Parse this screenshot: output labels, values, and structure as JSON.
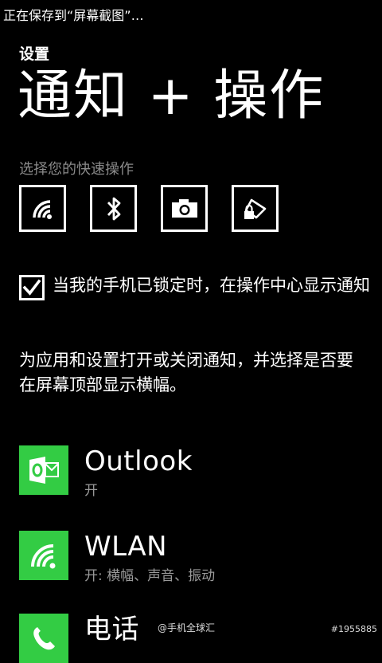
{
  "status_bar": {
    "text": "正在保存到“屏幕截图”…"
  },
  "header": {
    "section": "设置",
    "title": "通知 + 操作"
  },
  "quick_actions": {
    "label": "选择您的快速操作",
    "tiles": [
      {
        "icon": "wifi-icon"
      },
      {
        "icon": "bluetooth-icon"
      },
      {
        "icon": "camera-icon"
      },
      {
        "icon": "rotation-lock-icon"
      }
    ]
  },
  "lock_notification": {
    "checked": true,
    "label": "当我的手机已锁定时，在操作中心显示通知"
  },
  "description": "为应用和设置打开或关闭通知，并选择是否要在屏幕顶部显示横幅。",
  "apps": [
    {
      "name": "Outlook",
      "status": "开",
      "icon": "outlook-icon",
      "color": "#33cc44"
    },
    {
      "name": "WLAN",
      "status": "开: 横幅、声音、振动",
      "icon": "wifi-icon",
      "color": "#33cc44"
    },
    {
      "name": "电话",
      "status": "",
      "icon": "phone-icon",
      "color": "#33cc44"
    }
  ],
  "watermarks": {
    "source": "@手机全球汇",
    "id": "#1955885"
  }
}
